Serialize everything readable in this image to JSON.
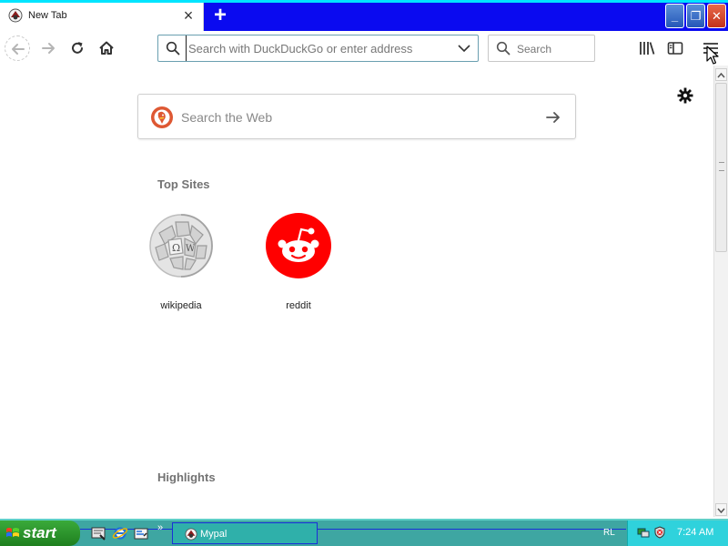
{
  "window": {
    "tab_title": "New Tab",
    "tab_close": "×",
    "new_tab": "+",
    "minimize": "_",
    "restore": "❐",
    "close": "✕"
  },
  "toolbar": {
    "url_placeholder": "Search with DuckDuckGo or enter address",
    "search_label": "Search"
  },
  "newtab": {
    "web_search_placeholder": "Search the Web",
    "top_sites_title": "Top Sites",
    "top_sites": [
      {
        "label": "wikipedia",
        "icon": "wikipedia-globe-icon"
      },
      {
        "label": "reddit",
        "icon": "reddit-alien-icon"
      }
    ],
    "highlights_title": "Highlights"
  },
  "taskbar": {
    "start_label": "start",
    "more": "»",
    "task_label": "Mypal",
    "rl": "RL",
    "clock": "7:24 AM"
  },
  "colors": {
    "titlebar": "#0a0af0",
    "reddit": "#ff0000",
    "taskbar": "#3ea6a2",
    "start": "#2a9a2a",
    "tray": "#2fd2dc"
  }
}
